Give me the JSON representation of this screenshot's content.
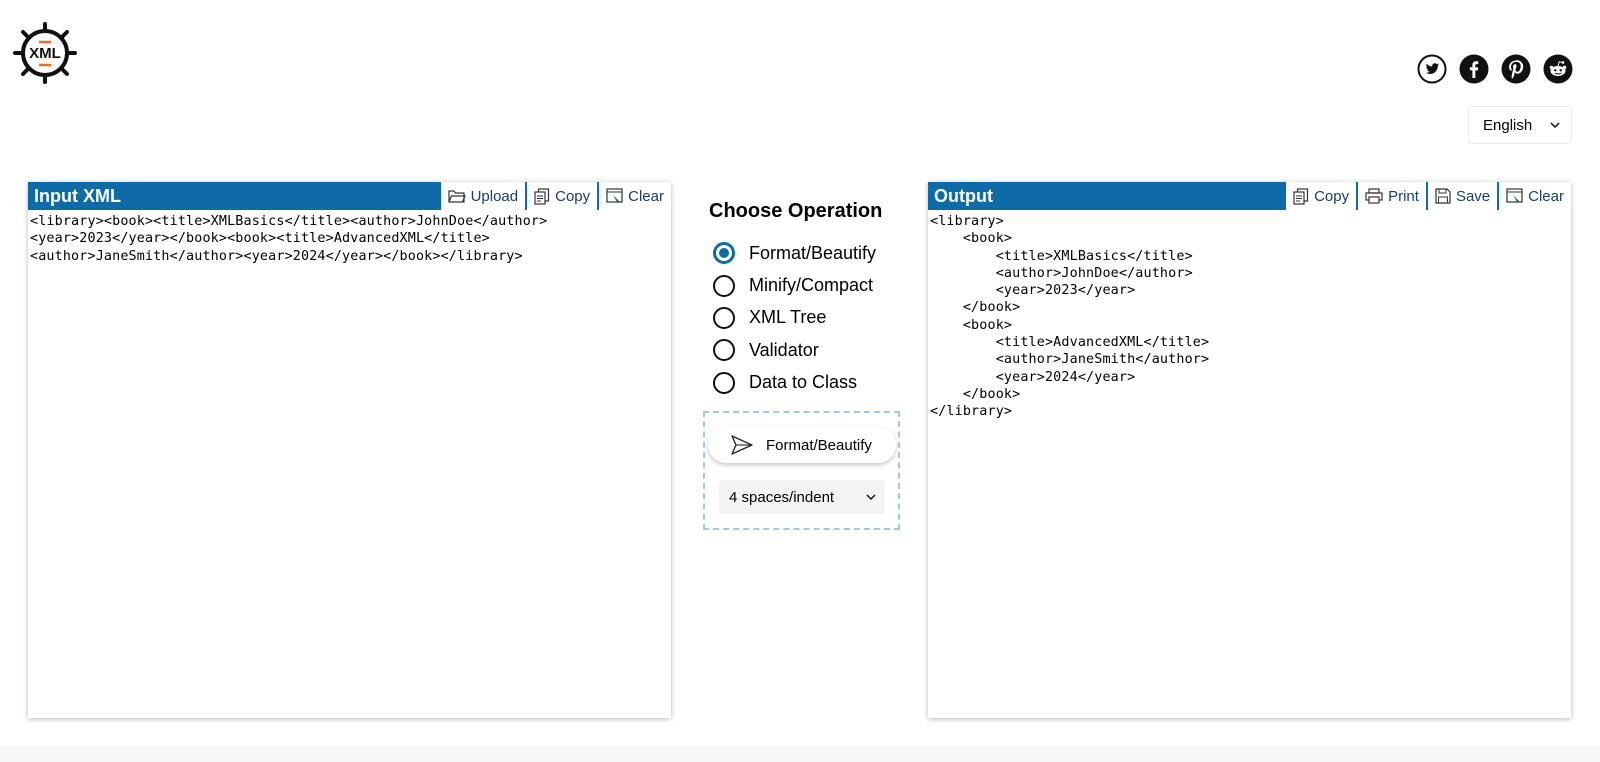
{
  "logo": {
    "text": "XML"
  },
  "social": [
    {
      "icon": "twitter-icon"
    },
    {
      "icon": "facebook-icon"
    },
    {
      "icon": "pinterest-icon"
    },
    {
      "icon": "reddit-icon"
    }
  ],
  "language": {
    "selected": "English"
  },
  "input_panel": {
    "title": "Input XML",
    "buttons": {
      "upload": "Upload",
      "copy": "Copy",
      "clear": "Clear"
    },
    "content": "<library><book><title>XMLBasics</title><author>JohnDoe</author>\n<year>2023</year></book><book><title>AdvancedXML</title>\n<author>JaneSmith</author><year>2024</year></book></library>"
  },
  "operations": {
    "heading": "Choose Operation",
    "options": [
      {
        "label": "Format/Beautify",
        "selected": true
      },
      {
        "label": "Minify/Compact",
        "selected": false
      },
      {
        "label": "XML Tree",
        "selected": false
      },
      {
        "label": "Validator",
        "selected": false
      },
      {
        "label": "Data to Class",
        "selected": false
      }
    ],
    "run_label": "Format/Beautify",
    "indent_selected": "4 spaces/indent"
  },
  "output_panel": {
    "title": "Output",
    "buttons": {
      "copy": "Copy",
      "print": "Print",
      "save": "Save",
      "clear": "Clear"
    },
    "content": "<library>\n    <book>\n        <title>XMLBasics</title>\n        <author>JohnDoe</author>\n        <year>2023</year>\n    </book>\n    <book>\n        <title>AdvancedXML</title>\n        <author>JaneSmith</author>\n        <year>2024</year>\n    </book>\n</library>"
  },
  "colors": {
    "accent": "#0e6ba8",
    "orange": "#f26b21"
  }
}
